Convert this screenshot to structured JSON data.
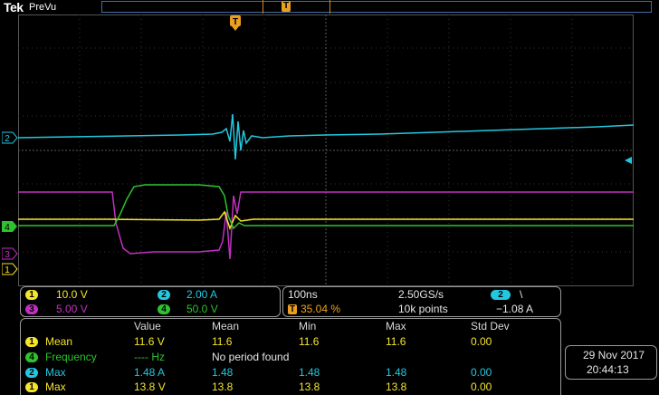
{
  "header": {
    "brand": "Tek",
    "mode": "PreVu",
    "trigger_letter": "T"
  },
  "channels": [
    {
      "num": "1",
      "scale": "10.0 V",
      "color": "#f5e52a"
    },
    {
      "num": "2",
      "scale": "2.00 A",
      "color": "#22c8e0"
    },
    {
      "num": "3",
      "scale": "5.00 V",
      "color": "#c030c0"
    },
    {
      "num": "4",
      "scale": "50.0 V",
      "color": "#2ec22e"
    }
  ],
  "timebase": {
    "time_per_div": "100ns",
    "sample_rate": "2.50GS/s",
    "trigger_position": "35.04 %",
    "record_length": "10k points",
    "trigger_source": "2",
    "trigger_slope": "\\",
    "trigger_level": "−1.08 A"
  },
  "measurements": {
    "headers": [
      "Value",
      "Mean",
      "Min",
      "Max",
      "Std Dev"
    ],
    "rows": [
      {
        "ch": "1",
        "name": "Mean",
        "value": "11.6 V",
        "mean": "11.6",
        "min": "11.6",
        "max": "11.6",
        "std": "0.00"
      },
      {
        "ch": "4",
        "name": "Frequency",
        "value": "---- Hz",
        "note": "No period found"
      },
      {
        "ch": "2",
        "name": "Max",
        "value": "1.48 A",
        "mean": "1.48",
        "min": "1.48",
        "max": "1.48",
        "std": "0.00"
      },
      {
        "ch": "1",
        "name": "Max",
        "value": "13.8 V",
        "mean": "13.8",
        "min": "13.8",
        "max": "13.8",
        "std": "0.00"
      }
    ]
  },
  "datetime": {
    "date": "29 Nov 2017",
    "time": "20:44:13"
  },
  "colors": {
    "grid": "#555555",
    "accent_orange": "#e9a020",
    "timebar": "#3f6ea5"
  }
}
